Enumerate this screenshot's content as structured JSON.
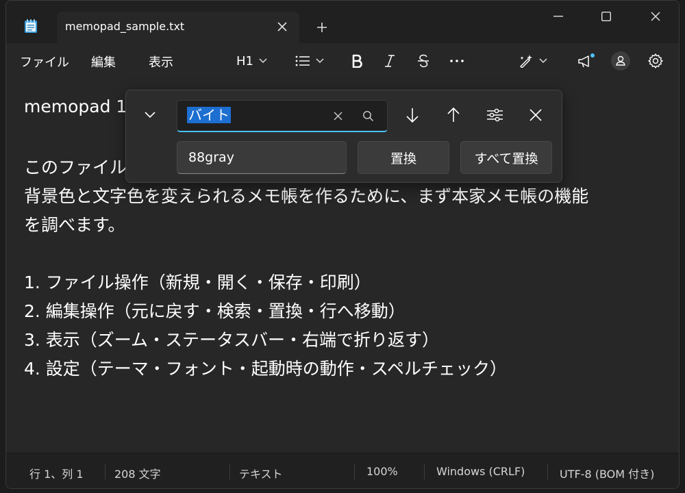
{
  "window": {
    "tab_title": "memopad_sample.txt"
  },
  "menu": {
    "file": "ファイル",
    "edit": "編集",
    "view": "表示"
  },
  "toolbar": {
    "heading": "H1"
  },
  "editor": {
    "lines": [
      "memopad 1",
      "",
      "このファイル",
      "背景色と文字色を変えられるメモ帳を作るために、まず本家メモ帳の機能",
      "を調べます。",
      "",
      "1. ファイル操作（新規・開く・保存・印刷）",
      "2. 編集操作（元に戻す・検索・置換・行へ移動）",
      "3. 表示（ズーム・ステータスバー・右端で折り返す）",
      "4. 設定（テーマ・フォント・起動時の動作・スペルチェック）"
    ]
  },
  "find_panel": {
    "search_value": "バイト",
    "replace_value": "88gray",
    "replace_label": "置換",
    "replace_all_label": "すべて置換"
  },
  "status": {
    "position": "行 1、列 1",
    "char_count": "208 文字",
    "format": "テキスト",
    "zoom": "100%",
    "line_ending": "Windows (CRLF)",
    "encoding": "UTF-8 (BOM 付き)"
  },
  "colors": {
    "accent": "#4cc2ff",
    "selection": "#1d6fd1",
    "background": "#272727"
  }
}
